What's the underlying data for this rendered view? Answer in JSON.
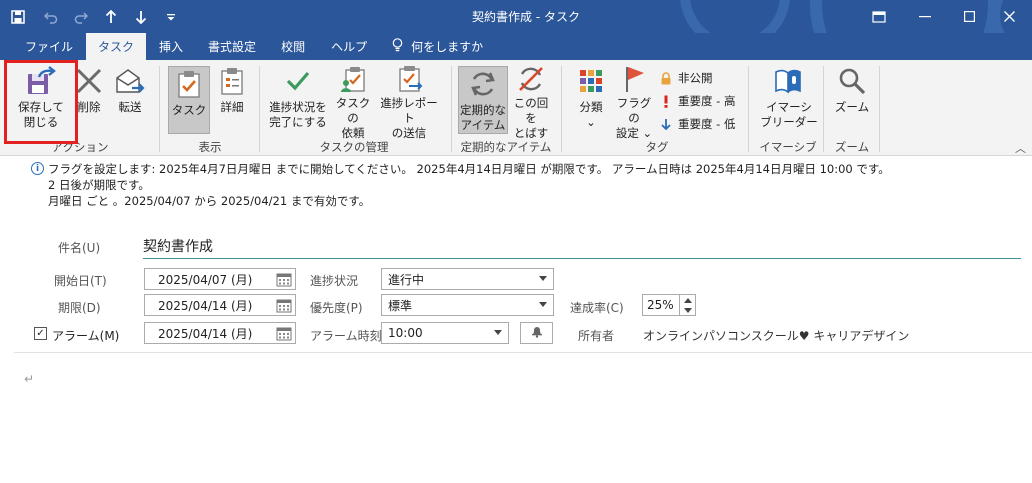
{
  "window": {
    "title": "契約書作成  -  タスク",
    "controls": {
      "restore": "⧉",
      "minimize": "—",
      "maximize": "☐",
      "close": "✕"
    }
  },
  "qat": {
    "save_icon": "save-icon",
    "undo_icon": "undo-icon",
    "redo_icon": "redo-icon",
    "up_icon": "up-arrow-icon",
    "down_icon": "down-arrow-icon",
    "customize_icon": "customize-icon"
  },
  "tabs": {
    "file": "ファイル",
    "task": "タスク",
    "insert": "挿入",
    "format": "書式設定",
    "review": "校閲",
    "help": "ヘルプ",
    "tell_me": "何をしますか"
  },
  "ribbon": {
    "action": {
      "save_close": [
        "保存して",
        "閉じる"
      ],
      "delete": "削除",
      "forward": "転送",
      "label": "アクション"
    },
    "show": {
      "task": "タスク",
      "details": "詳細",
      "label": "表示"
    },
    "manage": {
      "complete": [
        "進捗状況を",
        "完了にする"
      ],
      "assign": [
        "タスクの",
        "依頼"
      ],
      "send_report": [
        "進捗レポート",
        "の送信"
      ],
      "label": "タスクの管理"
    },
    "recurrence": {
      "recurring": [
        "定期的な",
        "アイテム"
      ],
      "skip": [
        "この回を",
        "とばす"
      ],
      "label": "定期的なアイテム"
    },
    "tags": {
      "categorize": [
        "分類",
        "⌄"
      ],
      "follow_up": [
        "フラグの",
        "設定 ⌄"
      ],
      "private": "非公開",
      "high": "重要度 - 高",
      "low": "重要度 - 低",
      "label": "タグ"
    },
    "immersive": {
      "reader": [
        "イマーシ",
        "ブリーダー"
      ],
      "label": "イマーシブ"
    },
    "zoom": {
      "zoom": "ズーム",
      "label": "ズーム"
    },
    "collapse": "︿"
  },
  "info": {
    "line1": "フラグを設定します:  2025年4月7日月曜日 までに開始してください。  2025年4月14日月曜日 が期限です。  アラーム日時は 2025年4月14日月曜日 10:00 です。",
    "line2": "2 日後が期限です。",
    "line3": "月曜日 ごと 。2025/04/07 から 2025/04/21 まで有効です。"
  },
  "form": {
    "subject_label": "件名(U)",
    "subject_value": "契約書作成",
    "start_label": "開始日(T)",
    "start_value": "2025/04/07 (月)",
    "due_label": "期限(D)",
    "due_value": "2025/04/14 (月)",
    "reminder_label": "アラーム(M)",
    "reminder_date": "2025/04/14 (月)",
    "reminder_checked": "✓",
    "status_label": "進捗状況",
    "status_value": "進行中",
    "priority_label": "優先度(P)",
    "priority_value": "標準",
    "reminder_time_label": "アラーム時刻",
    "reminder_time_value": "10:00",
    "complete_label": "達成率(C)",
    "complete_value": "25%",
    "owner_label": "所有者",
    "owner_value": "オンラインパソコンスクール♥ キャリアデザイン"
  },
  "body": {
    "paragraph_mark": "↵"
  },
  "colors": {
    "titlebar": "#2b579a",
    "ribbon": "#f3f3f3",
    "highlight": "#e32121",
    "subject_underline": "#3d8f95"
  }
}
